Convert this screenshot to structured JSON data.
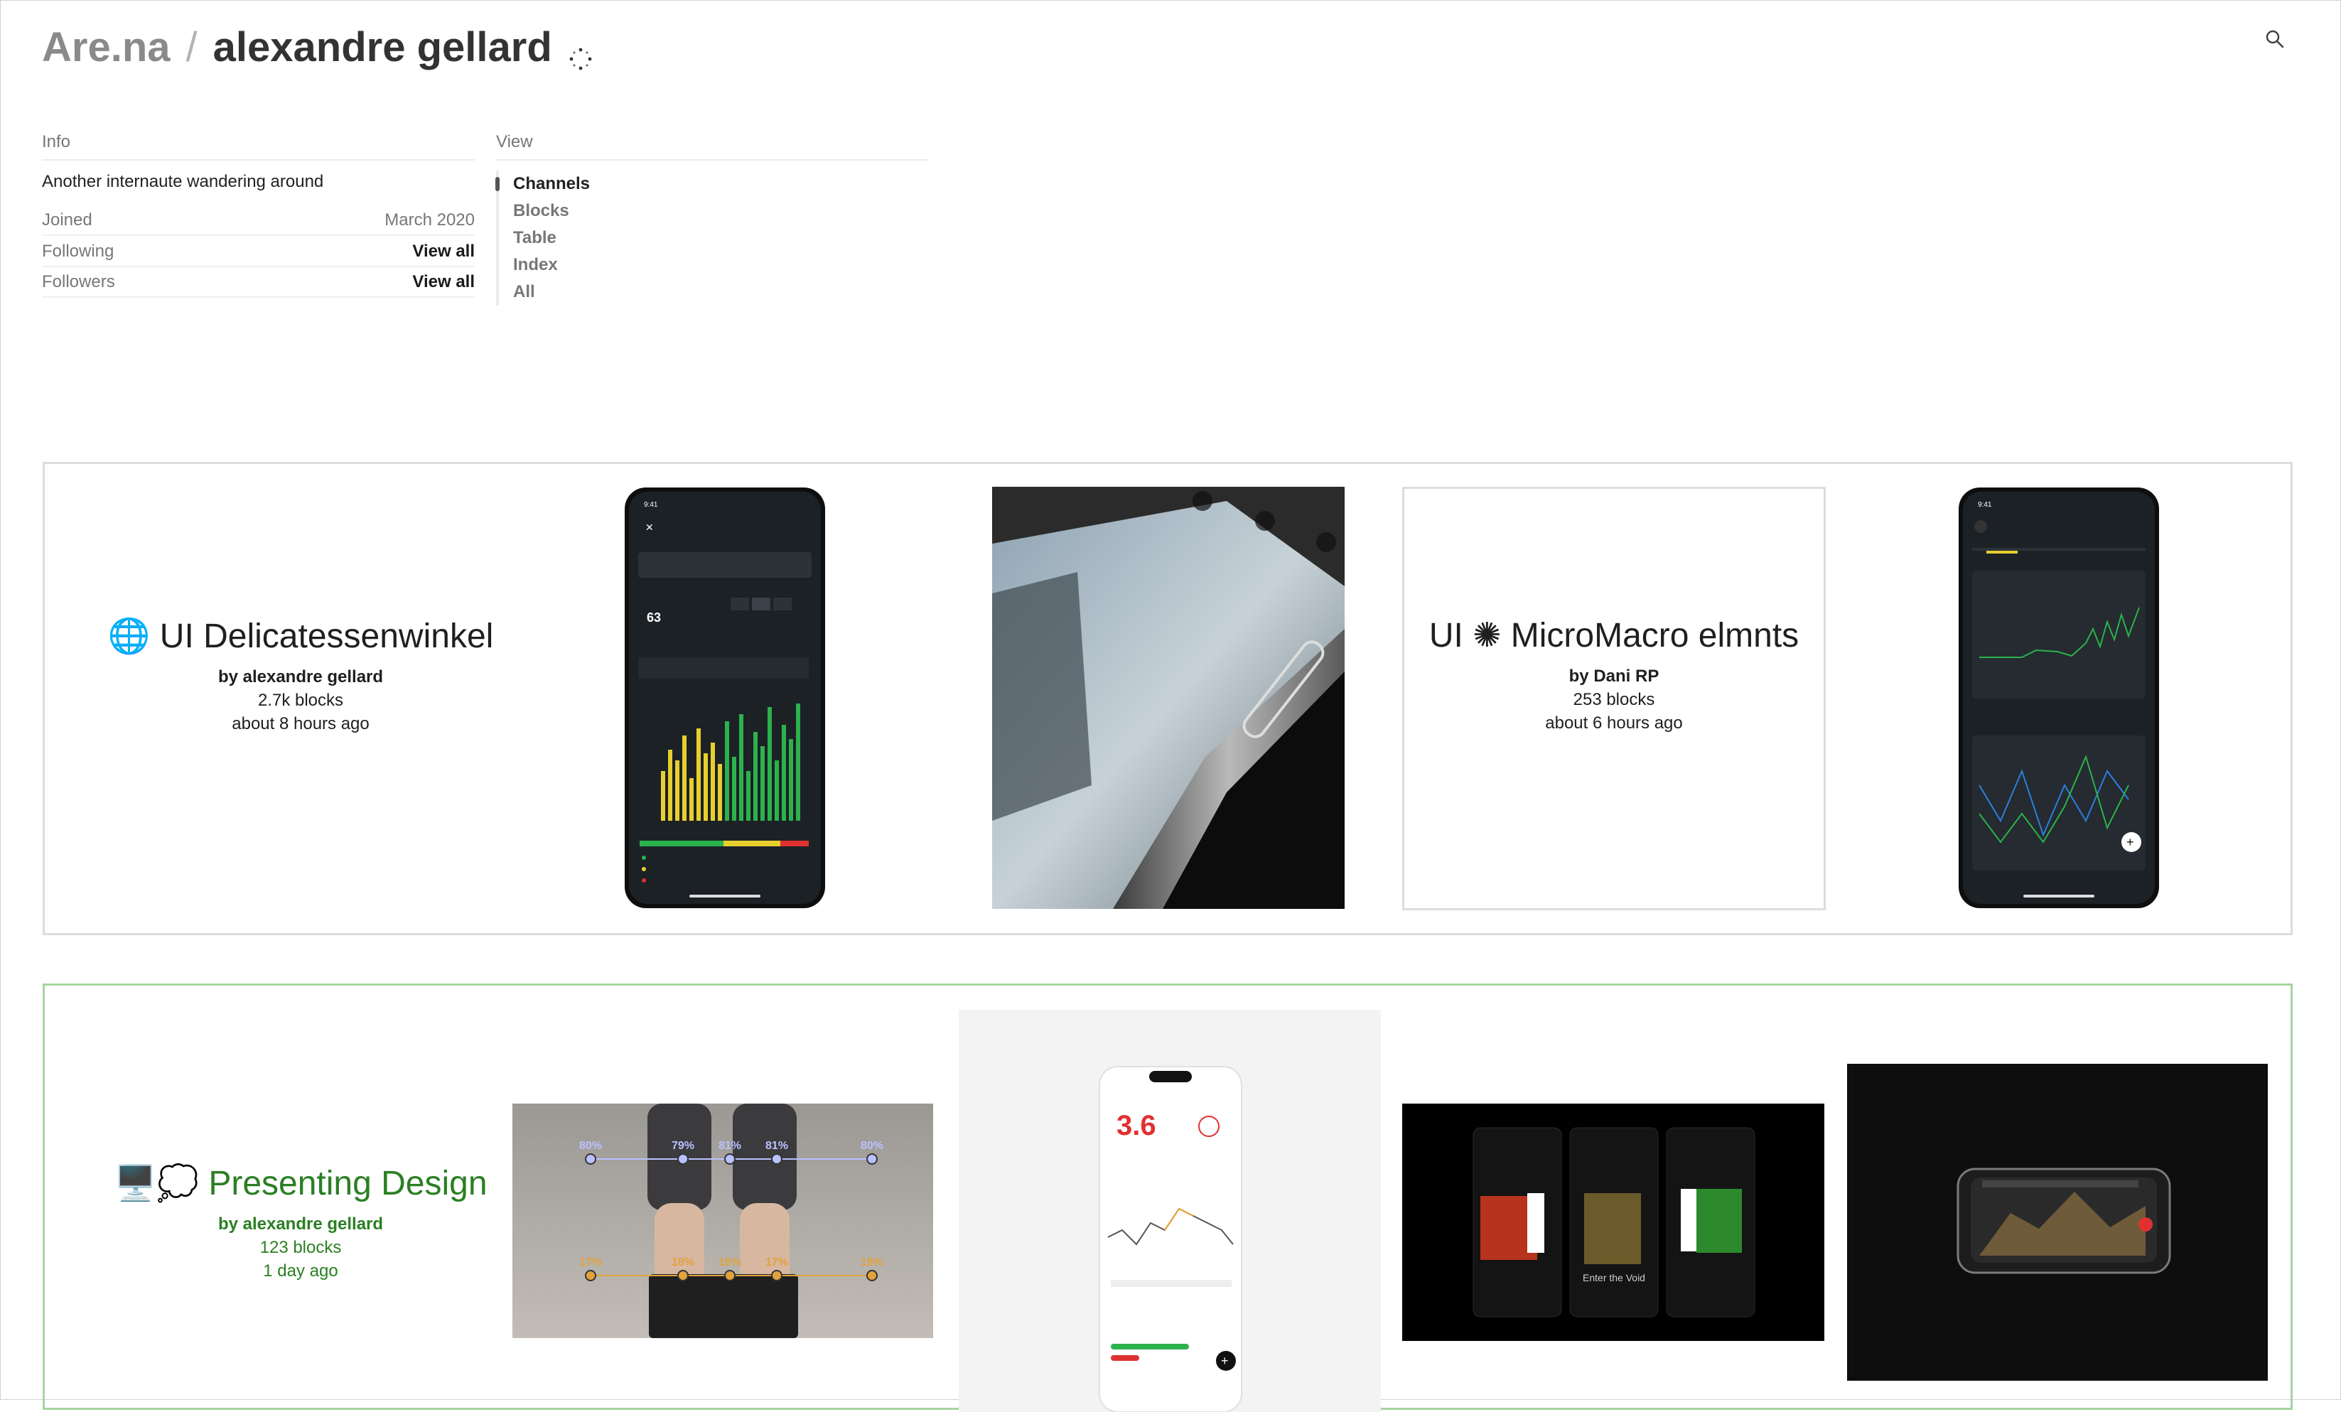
{
  "header": {
    "site": "Are.na",
    "separator": "/",
    "user": "alexandre gellard"
  },
  "info": {
    "heading": "Info",
    "bio": "Another internaute wandering around",
    "rows": [
      {
        "label": "Joined",
        "value": "March 2020"
      },
      {
        "label": "Following",
        "value": "View all"
      },
      {
        "label": "Followers",
        "value": "View all"
      }
    ]
  },
  "view": {
    "heading": "View",
    "items": [
      "Channels",
      "Blocks",
      "Table",
      "Index",
      "All"
    ],
    "selected": "Channels"
  },
  "channels": [
    {
      "emoji": "🌐",
      "title": "UI Delicatessenwinkel",
      "by": "by alexandre gellard",
      "count": "2.7k blocks",
      "updated": "about 8 hours ago",
      "blocks": [
        {
          "type": "image",
          "icon": "phone-recovery-screenshot"
        },
        {
          "type": "image",
          "icon": "camera-app-photo"
        },
        {
          "type": "channel",
          "title_prefix": "UI",
          "glyph": "✺",
          "title_suffix": "MicroMacro elmnts",
          "by": "by Dani RP",
          "count": "253 blocks",
          "updated": "about 6 hours ago"
        },
        {
          "type": "image",
          "icon": "phone-stress-monitor-screenshot"
        }
      ]
    },
    {
      "emoji": "🖥️💭",
      "title": "Presenting Design",
      "by": "by alexandre gellard",
      "count": "123 blocks",
      "updated": "1 day ago",
      "accent": "#2a7f22",
      "blocks": [
        {
          "type": "image",
          "icon": "smart-scale-photo"
        },
        {
          "type": "image",
          "icon": "phone-value-screenshot"
        },
        {
          "type": "image",
          "icon": "three-phones-screenshot"
        },
        {
          "type": "image",
          "icon": "phone-landscape-photo"
        }
      ]
    }
  ],
  "phone_text": {
    "recovery_value": "63",
    "big_value": "3.6",
    "void_text": "Enter the Void"
  },
  "scale_labels": [
    "80%",
    "79%",
    "81%",
    "81%",
    "80%",
    "17%",
    "18%",
    "16%",
    "17%",
    "18%"
  ],
  "colors": {
    "accent_green": "#2a7f22",
    "channel_border": "#dcdcdc",
    "private_border": "#a6d4a0"
  }
}
